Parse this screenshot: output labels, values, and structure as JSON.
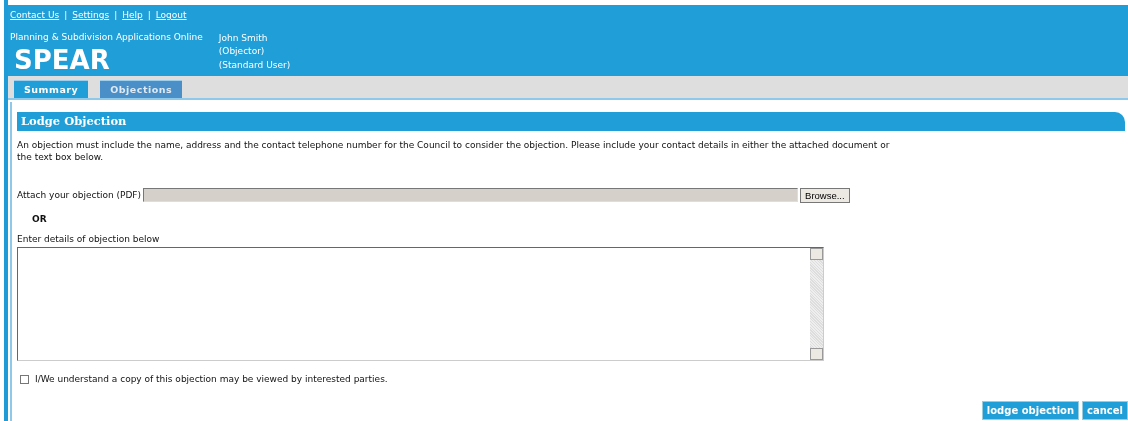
{
  "header": {
    "links": [
      "Contact Us",
      "Settings",
      "Help",
      "Logout"
    ],
    "link_separators": [
      "|",
      "|",
      "|"
    ],
    "app_subtitle": "Planning & Subdivision Applications Online",
    "app_name": "SPEAR",
    "user": {
      "name": "John Smith",
      "role": "(Objector)",
      "type": "(Standard User)"
    }
  },
  "tabs": [
    {
      "label": "Summary",
      "selected": false
    },
    {
      "label": "Objections",
      "selected": true
    }
  ],
  "section": {
    "title": "Lodge Objection",
    "instructions": "An objection must include the name, address and the contact telephone number for the Council to consider the objection. Please include your contact details in either the attached document or the text box below.",
    "attach": {
      "label": "Attach your objection (PDF)",
      "button": "Browse..."
    },
    "or": "OR",
    "details": {
      "label": "Enter details of objection below"
    },
    "consent": {
      "label": "I/We understand a copy of this objection may be viewed by interested parties.",
      "checked": false
    }
  },
  "buttons": [
    "lodge objection",
    "cancel"
  ]
}
